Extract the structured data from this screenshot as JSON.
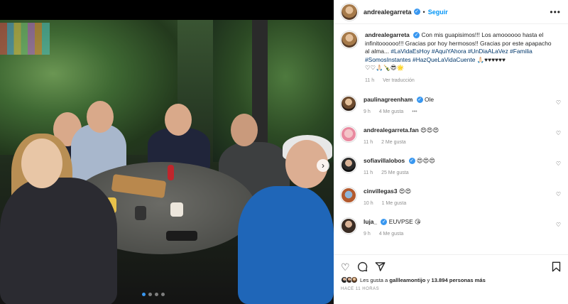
{
  "post": {
    "username": "andrealegarreta",
    "follow_label": "Seguir",
    "caption_text": "Con mis guapisimos!!! Los amoooooo hasta el infinitoooooo!!! Gracias por hoy hermosos!! Gracias por este apapacho al alma...",
    "hashtags": [
      "#LaVidaEsHoy",
      "#AquiYAhora",
      "#UnDiaALaVez",
      "#Familia",
      "#SomosInstantes",
      "#HazQueLaVidaCuente"
    ],
    "caption_emojis_inline": "🙏🏻♥♥♥♥♥♥",
    "caption_emojis_line": "♡♡🙏🏻🍾😎🌟",
    "caption_time": "11 h",
    "see_translation": "Ver traducción"
  },
  "comments": [
    {
      "user": "paulinagreenham",
      "verified": true,
      "text": "Ole",
      "time": "9 h",
      "likes": "4 Me gusta",
      "extra": "•••"
    },
    {
      "user": "andrealegarreta.fan",
      "verified": false,
      "text": "😍😍😍",
      "time": "11 h",
      "likes": "2 Me gusta"
    },
    {
      "user": "sofiavillalobos",
      "verified": true,
      "text": "😍😍😍",
      "time": "11 h",
      "likes": "25 Me gusta"
    },
    {
      "user": "cinvillegas3",
      "verified": false,
      "text": "😍😍",
      "time": "10 h",
      "likes": "1 Me gusta"
    },
    {
      "user": "luja_",
      "verified": true,
      "text": "EUVPSE 😘",
      "time": "9 h",
      "likes": "4 Me gusta"
    }
  ],
  "footer": {
    "likes_prefix": "Les gusta a ",
    "liker": "gallleamontijo",
    "likes_mid": " y ",
    "likes_count": "13.894 personas más",
    "date": "HACE 11 HORAS"
  },
  "icons": {
    "more": "more-icon",
    "verified": "verified-icon",
    "heart": "heart-icon",
    "comment": "comment-icon",
    "share": "share-icon",
    "bookmark": "bookmark-icon",
    "carousel_next": "chevron-right-icon"
  },
  "colors": {
    "accent": "#0095f6",
    "hashtag": "#00376b",
    "muted": "#8e8e8e"
  }
}
